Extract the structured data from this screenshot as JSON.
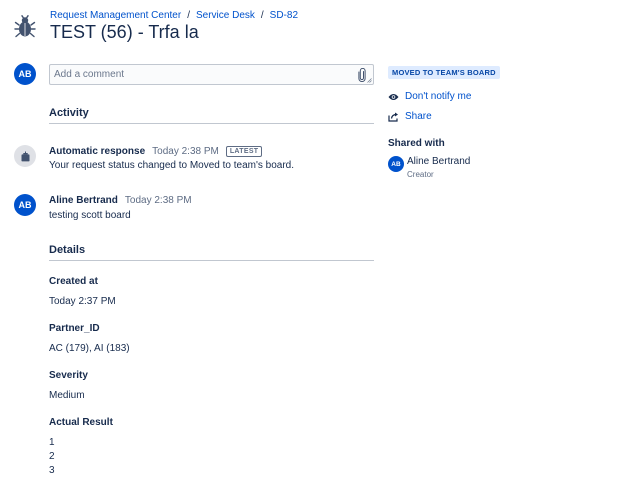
{
  "breadcrumb": [
    {
      "label": "Request Management Center"
    },
    {
      "label": "Service Desk"
    },
    {
      "label": "SD-82"
    }
  ],
  "title": "TEST (56) - Trfa la",
  "current_user": {
    "initials": "AB"
  },
  "comment": {
    "placeholder": "Add a comment"
  },
  "activity": {
    "heading": "Activity",
    "entries": [
      {
        "author": "Automatic response",
        "time": "Today 2:38 PM",
        "badge": "LATEST",
        "text": "Your request status changed to Moved to team's board."
      },
      {
        "author": "Aline Bertrand",
        "initials": "AB",
        "time": "Today 2:38 PM",
        "text": "testing scott board"
      }
    ]
  },
  "details": {
    "heading": "Details",
    "fields": [
      {
        "label": "Created at",
        "value": "Today 2:37 PM"
      },
      {
        "label": "Partner_ID",
        "value": "AC (179), AI (183)"
      },
      {
        "label": "Severity",
        "value": "Medium"
      },
      {
        "label": "Actual Result",
        "lines": [
          "1",
          "2",
          "3"
        ]
      }
    ]
  },
  "sidebar": {
    "status": "MOVED TO TEAM'S BOARD",
    "notify_label": "Don't notify me",
    "share_label": "Share",
    "shared_heading": "Shared with",
    "shared_users": [
      {
        "initials": "AB",
        "name": "Aline Bertrand",
        "role": "Creator"
      }
    ]
  },
  "icons": {
    "request_type": "bug-icon",
    "attachment": "paperclip-icon",
    "watch": "eye-icon",
    "share": "share-icon",
    "automation": "robot-icon"
  },
  "colors": {
    "link": "#0052cc",
    "avatar": "#0052cc",
    "status_bg": "#deebff",
    "status_text": "#0747a6",
    "text": "#172b4d"
  }
}
